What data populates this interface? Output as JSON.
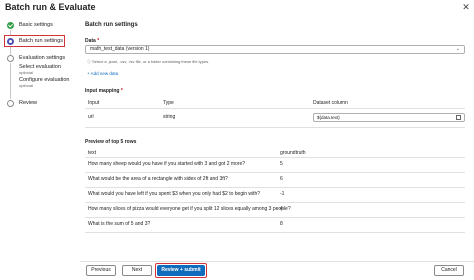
{
  "title": "Batch run & Evaluate",
  "steps": [
    {
      "label": "Basic settings",
      "state": "done"
    },
    {
      "label": "Batch run settings",
      "state": "active"
    },
    {
      "label": "Evaluation settings",
      "state": "pending",
      "substeps": [
        {
          "label": "Select evaluation",
          "note": "optional"
        },
        {
          "label": "Configure evaluation",
          "note": "optional"
        }
      ]
    },
    {
      "label": "Review",
      "state": "pending"
    }
  ],
  "main": {
    "heading": "Batch run settings",
    "data_label": "Data",
    "data_value": "math_test_data (version 1)",
    "data_hint": "Select a .jsonl, .csv, .tsv file, or a folder containing these file types.",
    "add_link": "+ Add new data",
    "input_mapping_label": "Input mapping",
    "mapping_headers": {
      "input": "Input",
      "type": "Type",
      "dataset": "Dataset column"
    },
    "mapping_row": {
      "input": "url",
      "type": "string",
      "dataset": "${data.text}"
    },
    "preview_title": "Preview of top 5 rows",
    "preview_headers": {
      "text": "text",
      "groundtruth": "groundtruth"
    },
    "preview_rows": [
      {
        "text": "How many sheep would you have if you started with 3 and got 2 more?",
        "groundtruth": "5"
      },
      {
        "text": "What would be the area of a rectangle with sides of 2ft and 3ft?",
        "groundtruth": "6"
      },
      {
        "text": "What would you have left if you spent $3 when you only had $2 to begin with?",
        "groundtruth": "-1"
      },
      {
        "text": "How many slices of pizza would everyone get if you split 12 slices equally among 3 people?",
        "groundtruth": "4"
      },
      {
        "text": "What is the sum of 5 and 3?",
        "groundtruth": "8"
      }
    ]
  },
  "footer": {
    "previous": "Previous",
    "next": "Next",
    "review_submit": "Review + submit",
    "cancel": "Cancel"
  },
  "colors": {
    "accent": "#0f6cbd",
    "highlight": "#d13438",
    "done": "#2f9e44",
    "active": "#4f52b2"
  }
}
